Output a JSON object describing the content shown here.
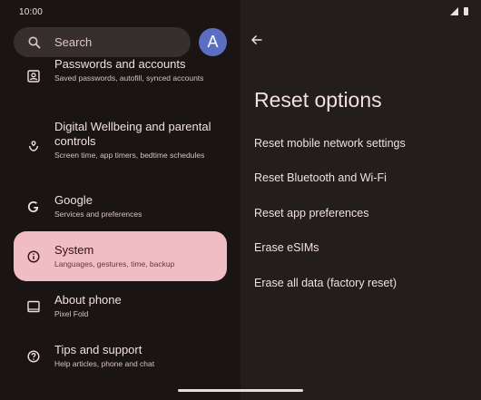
{
  "status_bar": {
    "time": "10:00",
    "icons": [
      "signal-icon",
      "battery-icon"
    ]
  },
  "search": {
    "label": "Search",
    "icon": "search-icon"
  },
  "avatar": {
    "initial": "A",
    "color": "#5b6ec2"
  },
  "settings": {
    "items": [
      {
        "icon": "account-box-icon",
        "title": "Passwords and accounts",
        "subtitle": "Saved passwords, autofill, synced accounts"
      },
      {
        "icon": "wellbeing-icon",
        "title": "Digital Wellbeing and parental controls",
        "subtitle": "Screen time, app timers, bedtime schedules"
      },
      {
        "icon": "google-g-icon",
        "title": "Google",
        "subtitle": "Services and preferences"
      },
      {
        "icon": "info-icon",
        "title": "System",
        "subtitle": "Languages, gestures, time, backup",
        "selected": true
      },
      {
        "icon": "tablet-icon",
        "title": "About phone",
        "subtitle": "Pixel Fold"
      },
      {
        "icon": "help-icon",
        "title": "Tips and support",
        "subtitle": "Help articles, phone and chat"
      }
    ]
  },
  "reset_options": {
    "back_icon": "back-arrow-icon",
    "title": "Reset options",
    "options": [
      "Reset mobile network settings",
      "Reset Bluetooth and Wi-Fi",
      "Reset app preferences",
      "Erase eSIMs",
      "Erase all data (factory reset)"
    ]
  },
  "colors": {
    "background": "#1b1415",
    "detail_pane": "#241d1e",
    "selected_item": "#f0bdc4",
    "search_bar": "#372e30",
    "text": "#f1dfe1"
  }
}
